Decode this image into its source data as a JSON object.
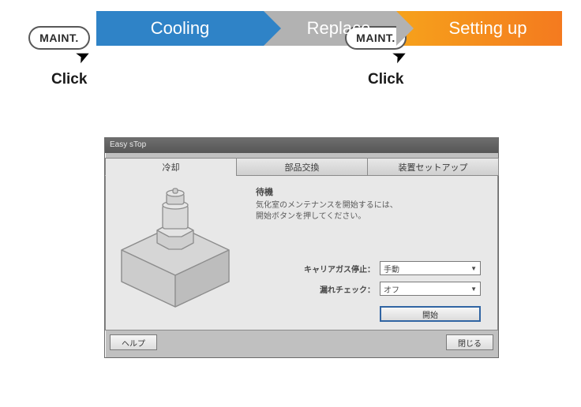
{
  "flow": {
    "steps": [
      "Cooling",
      "Replace",
      "Setting up"
    ]
  },
  "maint": {
    "label": "MAINT.",
    "click": "Click"
  },
  "dialog": {
    "title": "Easy sTop",
    "tabs": [
      "冷却",
      "部品交換",
      "装置セットアップ"
    ],
    "instr_title": "待機",
    "instr_line1": "気化室のメンテナンスを開始するには、",
    "instr_line2": "開始ボタンを押してください。",
    "field1_label": "キャリアガス停止：",
    "field1_value": "手動",
    "field2_label": "漏れチェック：",
    "field2_value": "オフ",
    "start_btn": "開始",
    "help_btn": "ヘルプ",
    "close_btn": "閉じる"
  }
}
